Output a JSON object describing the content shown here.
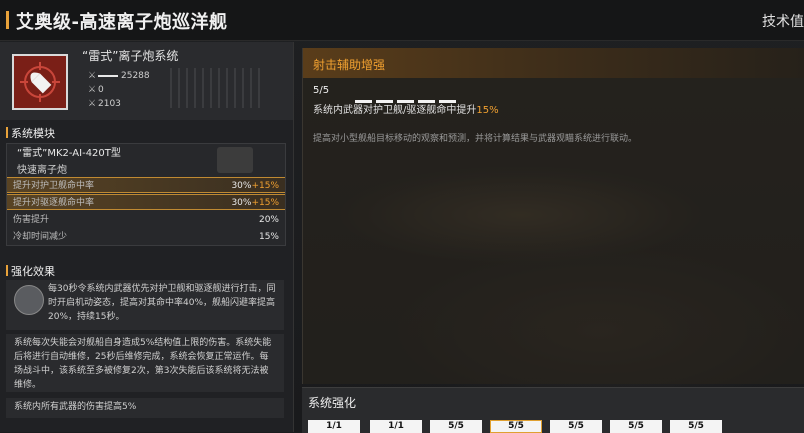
{
  "header": {
    "title": "艾奥级-高速离子炮巡洋舰",
    "right_label": "技术值",
    "accent_color": "#e8a23a"
  },
  "system": {
    "name": "“雷式”离子炮系统",
    "icon": "bullet-target-icon",
    "stats": [
      {
        "icon": "damage-icon",
        "value": "25288"
      },
      {
        "icon": "range-icon",
        "value": "0"
      },
      {
        "icon": "speed-icon",
        "value": "2103"
      }
    ]
  },
  "module_section": {
    "title": "系统模块",
    "module_name": "“雷式”MK2-AI-420T型",
    "module_sub": "快速离子炮",
    "rows": [
      {
        "label": "提升对护卫舰命中率",
        "value": "30%",
        "bonus": "+15%",
        "highlight": true
      },
      {
        "label": "提升对驱逐舰命中率",
        "value": "30%",
        "bonus": "+15%",
        "highlight": true
      },
      {
        "label": "伤害提升",
        "value": "20%",
        "bonus": "",
        "highlight": false
      },
      {
        "label": "冷却时间减少",
        "value": "15%",
        "bonus": "",
        "highlight": false
      }
    ]
  },
  "effects_section": {
    "title": "强化效果",
    "effect_1": "每30秒令系统内武器优先对护卫舰和驱逐舰进行打击，同时开启机动姿态，提高对其命中率40%，舰船闪避率提高20%，持续15秒。",
    "effect_2": "系统每次失能会对舰船自身造成5%结构值上限的伤害。系统失能后将进行自动维修，25秒后维修完成，系统会恢复正常运作。每场战斗中，该系统至多被修复2次，第3次失能后该系统将无法被维修。",
    "effect_3": "系统内所有武器的伤害提高5%"
  },
  "detail": {
    "title": "射击辅助增强",
    "level": "5/5",
    "segments": 5,
    "line_prefix": "系统内武器对护卫舰/驱逐舰命中提升",
    "line_value": "15%",
    "description": "提高对小型舰船目标移动的观察和预测，并将计算结果与武器观瞄系统进行联动。"
  },
  "strengthen": {
    "title": "系统强化",
    "levels": [
      "1/1",
      "1/1",
      "5/5",
      "5/5",
      "5/5",
      "5/5",
      "5/5"
    ],
    "active_index": 3
  }
}
